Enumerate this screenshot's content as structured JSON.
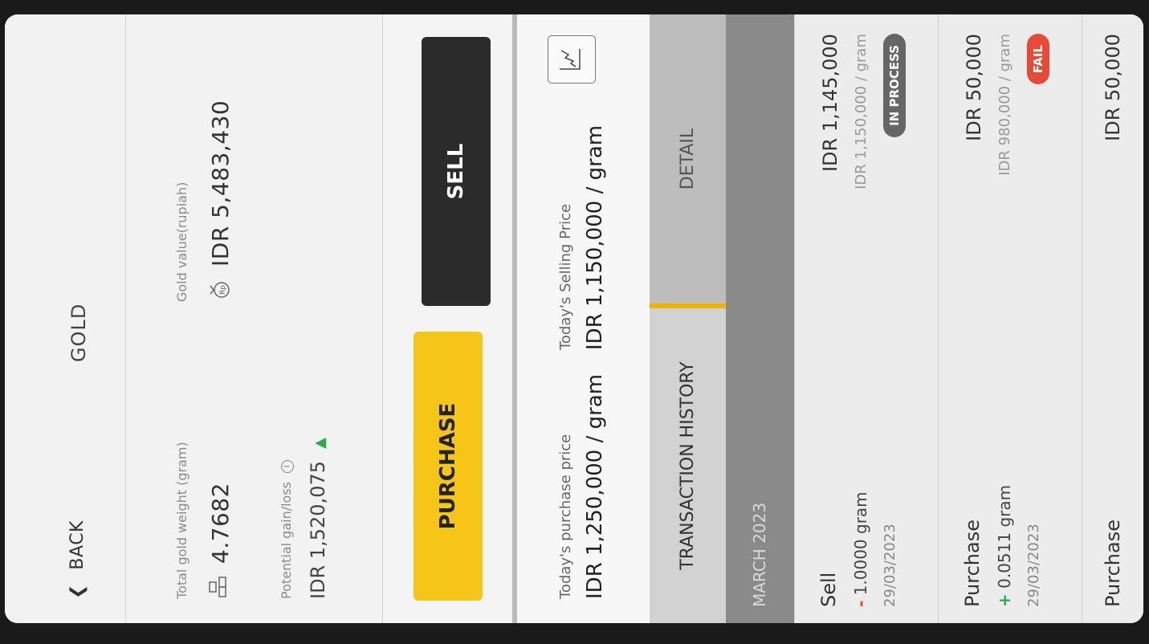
{
  "header": {
    "back_label": "BACK",
    "title": "GOLD"
  },
  "summary": {
    "weight_label": "Total gold weight (gram)",
    "weight_value": "4.7682",
    "value_label": "Gold value(rupiah)",
    "value_value": "IDR 5,483,430",
    "gain_label": "Potential gain/loss",
    "gain_value": "IDR 1,520,075"
  },
  "actions": {
    "purchase_label": "PURCHASE",
    "sell_label": "SELL"
  },
  "prices": {
    "purchase_label": "Today's purchase price",
    "purchase_value": "IDR 1,250,000 / gram",
    "selling_label": "Today's Selling Price",
    "selling_value": "IDR 1,150,000 / gram"
  },
  "tabs": {
    "history": "TRANSACTION HISTORY",
    "detail": "DETAIL"
  },
  "month": "MARCH 2023",
  "transactions": [
    {
      "type": "Sell",
      "sign": "-",
      "quantity": "1.0000 gram",
      "date": "29/03/2023",
      "amount": "IDR 1,145,000",
      "unit_price": "IDR 1,150,000 / gram",
      "status": "IN PROCESS"
    },
    {
      "type": "Purchase",
      "sign": "+",
      "quantity": "0.0511 gram",
      "date": "29/03/2023",
      "amount": "IDR 50,000",
      "unit_price": "IDR 980,000 / gram",
      "status": "FAIL"
    },
    {
      "type": "Purchase",
      "amount": "IDR 50,000"
    }
  ],
  "colors": {
    "accent_yellow": "#f5c518",
    "sell_dark": "#2b2b2b",
    "gain_green": "#2ea84a",
    "fail_red": "#e54b37"
  }
}
